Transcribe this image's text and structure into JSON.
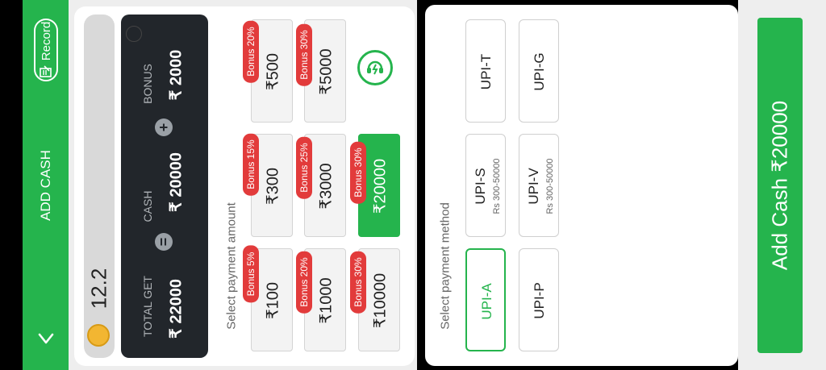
{
  "header": {
    "title": "ADD CASH",
    "record_label": "Record"
  },
  "balance": {
    "value": "12.2"
  },
  "summary": {
    "total_label": "TOTAL GET",
    "total_value": "₹ 22000",
    "cash_label": "CASH",
    "cash_value": "₹ 20000",
    "bonus_label": "BONUS",
    "bonus_value": "₹ 2000",
    "equals": "=",
    "plus": "+"
  },
  "amounts": {
    "label": "Select payment amount",
    "items": [
      {
        "value": "₹100",
        "bonus": "Bonus 5%"
      },
      {
        "value": "₹300",
        "bonus": "Bonus 15%"
      },
      {
        "value": "₹500",
        "bonus": "Bonus 20%"
      },
      {
        "value": "₹1000",
        "bonus": "Bonus 20%"
      },
      {
        "value": "₹3000",
        "bonus": "Bonus 25%"
      },
      {
        "value": "₹5000",
        "bonus": "Bonus 30%"
      },
      {
        "value": "₹10000",
        "bonus": "Bonus 30%"
      },
      {
        "value": "₹20000",
        "bonus": "Bonus 30%"
      }
    ]
  },
  "methods": {
    "label": "Select payment method",
    "items": [
      {
        "name": "UPI-A",
        "range": ""
      },
      {
        "name": "UPI-S",
        "range": "Rs 300-50000"
      },
      {
        "name": "UPI-T",
        "range": ""
      },
      {
        "name": "UPI-P",
        "range": ""
      },
      {
        "name": "UPI-V",
        "range": "Rs 300-50000"
      },
      {
        "name": "UPI-G",
        "range": ""
      }
    ]
  },
  "action": {
    "add_label": "Add Cash ₹20000"
  },
  "colors": {
    "accent": "#25b44d",
    "badge": "#e23b3b",
    "summary_bg": "#22262b"
  },
  "icons": [
    "chevron-down-icon",
    "record-icon",
    "coin-icon",
    "support-icon"
  ]
}
